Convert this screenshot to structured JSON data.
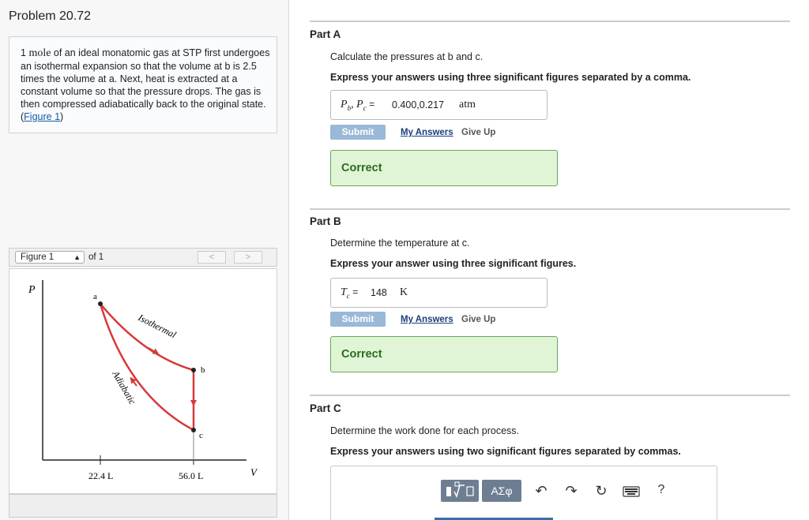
{
  "problem": {
    "title": "Problem 20.72",
    "text_prefix": "1 ",
    "text_mole": "mole",
    "text_body": " of an ideal monatomic gas at STP first undergoes an isothermal expansion so that the volume at b is 2.5 times the volume at a. Next, heat is extracted at a constant volume so that the pressure drops. The gas is then compressed adiabatically back to the original state. (",
    "figure_link": "Figure 1",
    "text_suffix": ")"
  },
  "figure": {
    "selector_value": "Figure 1",
    "of_label": "of 1",
    "prev": "<",
    "next": ">",
    "axis_p": "P",
    "axis_v": "V",
    "point_a": "a",
    "point_b": "b",
    "point_c": "c",
    "tick_1": "22.4 L",
    "tick_2": "56.0 L",
    "label_isothermal": "Isothermal",
    "label_adiabatic": "Adiabatic",
    "curve_color": "#d63a3a"
  },
  "parts": [
    {
      "label": "Part A",
      "question": "Calculate the pressures at b and c.",
      "instruction": "Express your answers using three significant figures separated by a comma.",
      "variable": "P_b, P_c",
      "answer": "0.400,0.217",
      "unit": "atm",
      "submit": "Submit",
      "my_answers": "My Answers",
      "give_up": "Give Up",
      "status": "Correct"
    },
    {
      "label": "Part B",
      "question": "Determine the temperature at c.",
      "instruction": "Express your answer using three significant figures.",
      "variable": "T_c",
      "answer": "148",
      "unit": "K",
      "submit": "Submit",
      "my_answers": "My Answers",
      "give_up": "Give Up",
      "status": "Correct"
    },
    {
      "label": "Part C",
      "question": "Determine the work done for each process.",
      "instruction": "Express your answers using two significant figures separated by commas.",
      "toolbar": {
        "templates_icon": "template-icon",
        "symbols_label": "ΑΣφ",
        "undo_icon": "undo-icon",
        "redo_icon": "redo-icon",
        "reset_icon": "reset-icon",
        "keyboard_icon": "keyboard-icon",
        "help_label": "?"
      }
    }
  ],
  "colors": {
    "submit_bg": "#9ab8d8",
    "correct_bg": "#dff5d6",
    "correct_border": "#69a75a",
    "link": "#1a3f7a"
  }
}
